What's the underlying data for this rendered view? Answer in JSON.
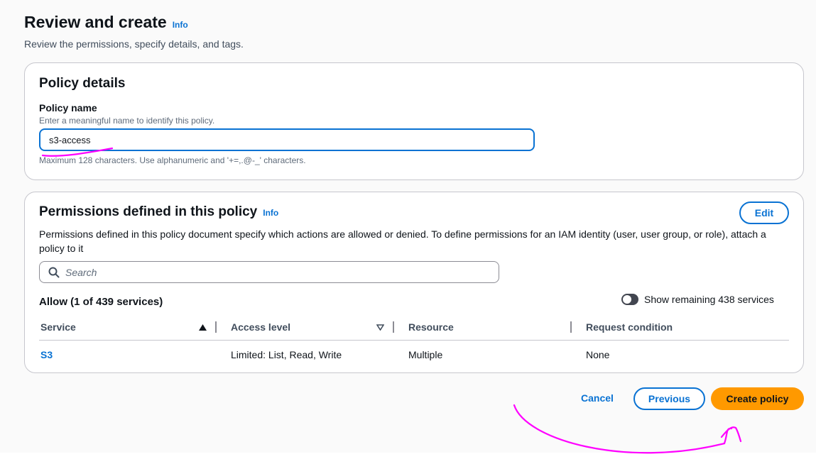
{
  "header": {
    "title": "Review and create",
    "info_label": "Info",
    "description": "Review the permissions, specify details, and tags."
  },
  "policy_details": {
    "title": "Policy details",
    "name_label": "Policy name",
    "name_description": "Enter a meaningful name to identify this policy.",
    "name_value": "s3-access",
    "name_constraint": "Maximum 128 characters. Use alphanumeric and '+=,.@-_' characters."
  },
  "permissions": {
    "title": "Permissions defined in this policy",
    "info_label": "Info",
    "edit_label": "Edit",
    "description": "Permissions defined in this policy document specify which actions are allowed or denied. To define permissions for an IAM identity (user, user group, or role), attach a policy to it",
    "search_placeholder": "Search",
    "allow_heading": "Allow (1 of 439 services)",
    "toggle_label": "Show remaining 438 services",
    "toggle_on": false,
    "columns": [
      "Service",
      "Access level",
      "Resource",
      "Request condition"
    ],
    "rows": [
      {
        "service": "S3",
        "access_level": "Limited: List, Read, Write",
        "resource": "Multiple",
        "request_condition": "None"
      }
    ]
  },
  "footer": {
    "cancel_label": "Cancel",
    "previous_label": "Previous",
    "create_label": "Create policy"
  },
  "colors": {
    "accent": "#0972d3",
    "primary_button": "#ff9900",
    "annotation": "#ff00ff"
  },
  "icons": [
    "search-icon",
    "sort-ascending-icon",
    "sort-descending-icon"
  ]
}
